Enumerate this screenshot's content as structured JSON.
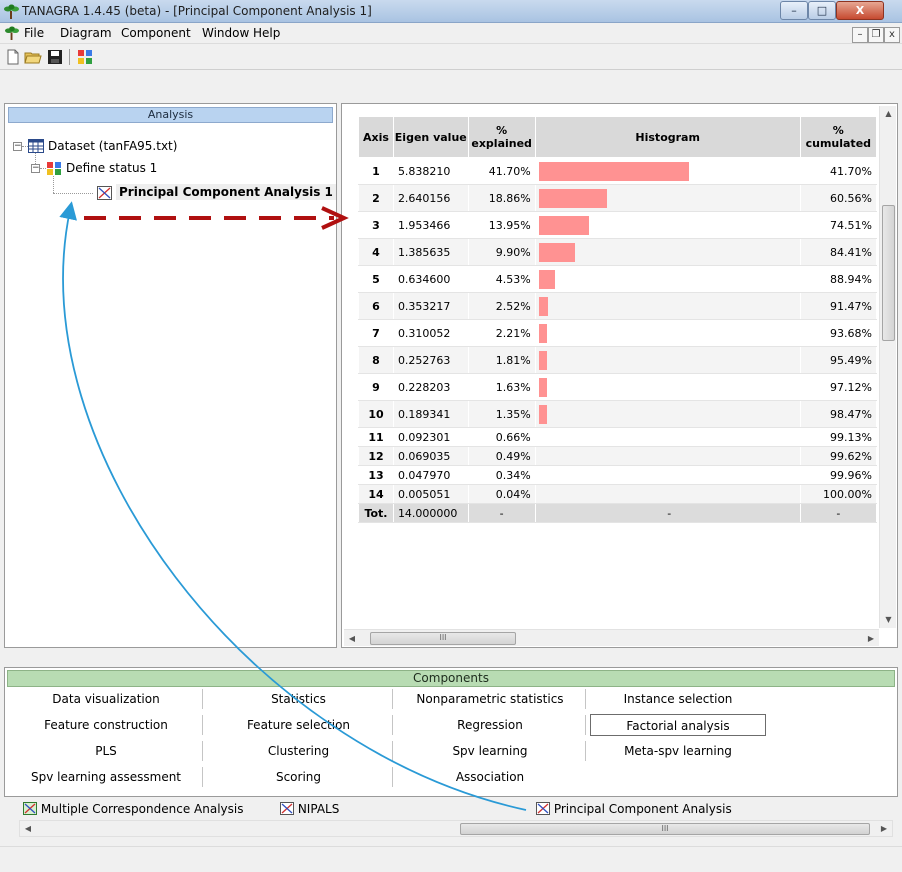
{
  "window": {
    "title": "TANAGRA 1.4.45 (beta) - [Principal Component Analysis 1]",
    "minimize": "–",
    "maximize": "□",
    "close": "X"
  },
  "menu": {
    "file": "File",
    "diagram": "Diagram",
    "component": "Component",
    "window": "Window",
    "help": "Help"
  },
  "mdi_buttons": {
    "minimize": "–",
    "restore": "❐",
    "close": "x"
  },
  "analysis": {
    "header": "Analysis",
    "dataset": "Dataset (tanFA95.txt)",
    "define_status": "Define status 1",
    "pca": "Principal Component Analysis 1"
  },
  "table": {
    "headers": {
      "axis": "Axis",
      "eigen": "Eigen value",
      "explained": "% explained",
      "histogram": "Histogram",
      "cumulated": "% cumulated"
    },
    "rows": [
      {
        "axis": "1",
        "eigen": "5.838210",
        "explained": "41.70%",
        "cumulated": "41.70%",
        "pct": 41.7
      },
      {
        "axis": "2",
        "eigen": "2.640156",
        "explained": "18.86%",
        "cumulated": "60.56%",
        "pct": 18.86
      },
      {
        "axis": "3",
        "eigen": "1.953466",
        "explained": "13.95%",
        "cumulated": "74.51%",
        "pct": 13.95
      },
      {
        "axis": "4",
        "eigen": "1.385635",
        "explained": "9.90%",
        "cumulated": "84.41%",
        "pct": 9.9
      },
      {
        "axis": "5",
        "eigen": "0.634600",
        "explained": "4.53%",
        "cumulated": "88.94%",
        "pct": 4.53
      },
      {
        "axis": "6",
        "eigen": "0.353217",
        "explained": "2.52%",
        "cumulated": "91.47%",
        "pct": 2.52
      },
      {
        "axis": "7",
        "eigen": "0.310052",
        "explained": "2.21%",
        "cumulated": "93.68%",
        "pct": 2.21
      },
      {
        "axis": "8",
        "eigen": "0.252763",
        "explained": "1.81%",
        "cumulated": "95.49%",
        "pct": 1.81
      },
      {
        "axis": "9",
        "eigen": "0.228203",
        "explained": "1.63%",
        "cumulated": "97.12%",
        "pct": 1.63
      },
      {
        "axis": "10",
        "eigen": "0.189341",
        "explained": "1.35%",
        "cumulated": "98.47%",
        "pct": 1.35
      },
      {
        "axis": "11",
        "eigen": "0.092301",
        "explained": "0.66%",
        "cumulated": "99.13%"
      },
      {
        "axis": "12",
        "eigen": "0.069035",
        "explained": "0.49%",
        "cumulated": "99.62%"
      },
      {
        "axis": "13",
        "eigen": "0.047970",
        "explained": "0.34%",
        "cumulated": "99.96%"
      },
      {
        "axis": "14",
        "eigen": "0.005051",
        "explained": "0.04%",
        "cumulated": "100.00%"
      }
    ],
    "total": {
      "axis": "Tot.",
      "eigen": "14.000000",
      "explained": "-",
      "histogram": "-",
      "cumulated": "-"
    },
    "bar_color": "#ff9292"
  },
  "components": {
    "header": "Components",
    "tabs": [
      "Data visualization",
      "Statistics",
      "Nonparametric statistics",
      "Instance selection",
      "Feature construction",
      "Feature selection",
      "Regression",
      "Factorial analysis",
      "PLS",
      "Clustering",
      "Spv learning",
      "Meta-spv learning",
      "Spv learning assessment",
      "Scoring",
      "Association"
    ],
    "methods": [
      "Multiple Correspondence Analysis",
      "NIPALS",
      "Principal Component Analysis"
    ]
  },
  "scroll_grip": "III",
  "annotation": {
    "arrow_color": "#b01010",
    "curve_color": "#2a9ad6"
  }
}
